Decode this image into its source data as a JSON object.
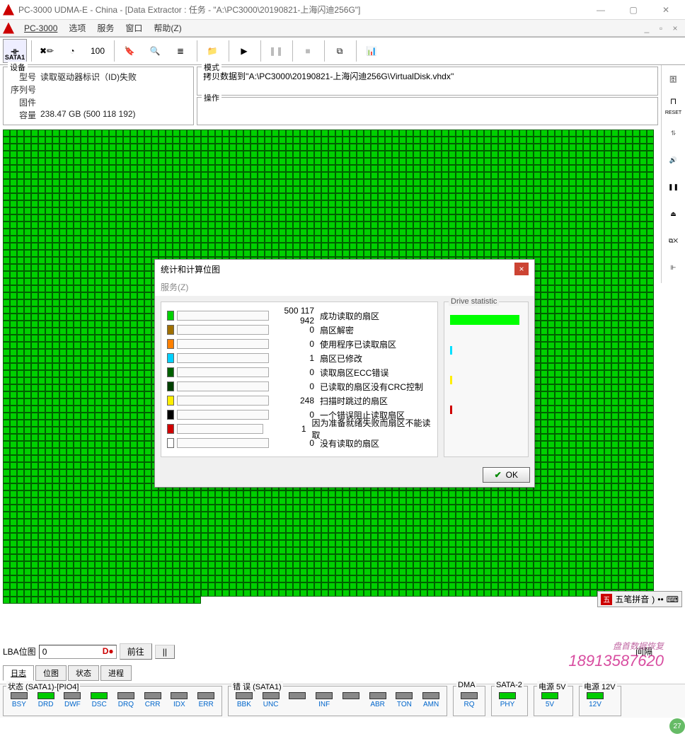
{
  "window": {
    "title": "PC-3000 UDMA-E - China - [Data Extractor : 任务 - \"A:\\PC3000\\20190821-上海闪迪256G\"]",
    "min": "—",
    "max": "▢",
    "close": "✕"
  },
  "menu": {
    "app": "PC-3000",
    "items": [
      "选项",
      "服务",
      "窗口",
      "帮助(Z)"
    ]
  },
  "toolbar": {
    "sata": "SATA1"
  },
  "device": {
    "legend": "设备",
    "model_label": "型号",
    "model": "读取驱动器标识（ID)失败",
    "serial_label": "序列号",
    "serial": "",
    "fw_label": "固件",
    "fw": "",
    "cap_label": "容量",
    "cap": "238.47 GB (500 118 192)"
  },
  "mode": {
    "legend": "模式",
    "text": "拷贝数据到''A:\\PC3000\\20190821-上海闪迪256G\\VirtualDisk.vhdx''"
  },
  "ops": {
    "legend": "操作"
  },
  "lba": {
    "label": "LBA位图",
    "value": "0",
    "goto": "前往",
    "pause": "||"
  },
  "tabs": [
    "日志",
    "位图",
    "状态",
    "进程"
  ],
  "dialog": {
    "title": "统计和计算位图",
    "menu": "服务(Z)",
    "drive_stat": "Drive statistic",
    "ok": "OK",
    "stats": [
      {
        "color": "#00d000",
        "value": "500 117 942",
        "label": "成功读取的扇区"
      },
      {
        "color": "#a07000",
        "value": "0",
        "label": "扇区解密"
      },
      {
        "color": "#ff8000",
        "value": "0",
        "label": "使用程序已读取扇区"
      },
      {
        "color": "#00d0ff",
        "value": "1",
        "label": "扇区已修改"
      },
      {
        "color": "#006000",
        "value": "0",
        "label": "读取扇区ECC错误"
      },
      {
        "color": "#004000",
        "value": "0",
        "label": "已读取的扇区没有CRC控制"
      },
      {
        "color": "#ffee00",
        "value": "248",
        "label": "扫描时跳过的扇区"
      },
      {
        "color": "#000000",
        "value": "0",
        "label": "一个错误阻止读取扇区"
      },
      {
        "color": "#d00000",
        "value": "1",
        "label": "因为准备就绪失败而扇区不能读取"
      },
      {
        "color": "#ffffff",
        "value": "0",
        "label": "没有读取的扇区"
      }
    ],
    "drive_bars": [
      {
        "color": "#00ff00",
        "h": 14,
        "w": 98
      },
      {
        "color": "#00e0ff",
        "h": 12,
        "w": 3
      },
      {
        "color": "#ffee00",
        "h": 12,
        "w": 3
      },
      {
        "color": "#d00000",
        "h": 12,
        "w": 3
      }
    ]
  },
  "status": {
    "group1": "状态 (SATA1)-[PIO4]",
    "group2": "错 误 (SATA1)",
    "dma": "DMA",
    "sata2": "SATA-2",
    "pwr5": "电源 5V",
    "pwr12": "电源 12V",
    "g1": [
      {
        "l": "BSY",
        "on": false
      },
      {
        "l": "DRD",
        "on": true
      },
      {
        "l": "DWF",
        "on": false
      },
      {
        "l": "DSC",
        "on": true
      },
      {
        "l": "DRQ",
        "on": false
      },
      {
        "l": "CRR",
        "on": false
      },
      {
        "l": "IDX",
        "on": false
      },
      {
        "l": "ERR",
        "on": false
      }
    ],
    "g2": [
      {
        "l": "BBK",
        "on": false
      },
      {
        "l": "UNC",
        "on": false
      },
      {
        "l": "",
        "on": false
      },
      {
        "l": "INF",
        "on": false
      },
      {
        "l": "",
        "on": false
      },
      {
        "l": "ABR",
        "on": false
      },
      {
        "l": "TON",
        "on": false
      },
      {
        "l": "AMN",
        "on": false
      }
    ],
    "rq": {
      "l": "RQ",
      "on": false
    },
    "phy": {
      "l": "PHY",
      "on": true
    },
    "v5": {
      "l": "5V",
      "on": true
    },
    "v12": {
      "l": "12V",
      "on": true
    }
  },
  "ime": {
    "text": "五笔拼音"
  },
  "watermark": {
    "line1": "盘首数据恢复",
    "phone": "18913587620"
  },
  "side_labels": {
    "reset": "RESET"
  },
  "badge": "27",
  "bottom": {
    "gap": "间隔"
  }
}
